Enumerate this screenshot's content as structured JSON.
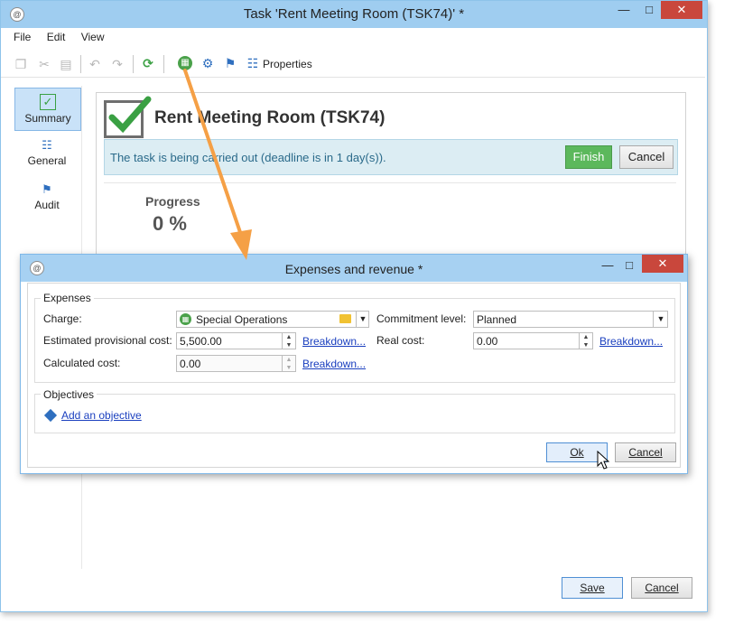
{
  "main_window": {
    "title": "Task 'Rent Meeting Room (TSK74)' *",
    "menu": [
      "File",
      "Edit",
      "View"
    ],
    "toolbar": {
      "properties_label": "Properties"
    },
    "sidebar": [
      {
        "label": "Summary",
        "icon": "summary-icon",
        "active": true
      },
      {
        "label": "General",
        "icon": "general-icon",
        "active": false
      },
      {
        "label": "Audit",
        "icon": "audit-icon",
        "active": false
      }
    ],
    "task": {
      "heading": "Rent Meeting Room (TSK74)",
      "status_text": "The task is being carried out (deadline is in 1 day(s)).",
      "finish_label": "Finish",
      "cancel_label": "Cancel",
      "progress_label": "Progress",
      "progress_value": "0 %"
    },
    "save_label": "Save",
    "cancel_label": "Cancel"
  },
  "dialog": {
    "title": "Expenses and revenue *",
    "expenses_legend": "Expenses",
    "charge_label": "Charge:",
    "charge_value": "Special Operations",
    "commitment_label": "Commitment level:",
    "commitment_value": "Planned",
    "est_cost_label": "Estimated provisional cost:",
    "est_cost_value": "5,500.00",
    "real_cost_label": "Real cost:",
    "real_cost_value": "0.00",
    "calc_cost_label": "Calculated cost:",
    "calc_cost_value": "0.00",
    "breakdown_label": "Breakdown...",
    "objectives_legend": "Objectives",
    "add_objective_label": "Add an objective",
    "ok_label": "Ok",
    "cancel_label": "Cancel"
  },
  "colors": {
    "titlebar": "#9fcdf0",
    "close_button": "#c9473c",
    "finish_button": "#5cb85c",
    "status_bar": "#dcedf3",
    "arrow": "#f5a046",
    "link": "#1a3fbf"
  }
}
